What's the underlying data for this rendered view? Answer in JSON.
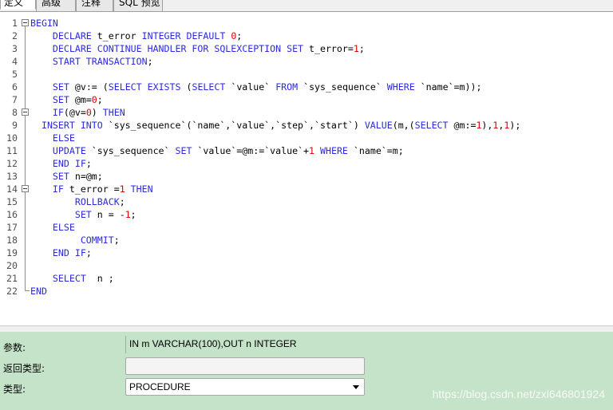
{
  "tabs": [
    {
      "label": "定义",
      "active": true
    },
    {
      "label": "高级",
      "active": false
    },
    {
      "label": "注释",
      "active": false
    },
    {
      "label": "SQL 预览",
      "active": false
    }
  ],
  "editor": {
    "lines": [
      {
        "n": "1",
        "tokens": [
          [
            "kw",
            "BEGIN"
          ]
        ]
      },
      {
        "n": "2",
        "tokens": [
          [
            "p",
            "    "
          ],
          [
            "kw",
            "DECLARE"
          ],
          [
            "p",
            " t_error "
          ],
          [
            "kw",
            "INTEGER DEFAULT"
          ],
          [
            "p",
            " "
          ],
          [
            "num",
            "0"
          ],
          [
            "p",
            ";"
          ]
        ]
      },
      {
        "n": "3",
        "tokens": [
          [
            "p",
            "    "
          ],
          [
            "kw",
            "DECLARE CONTINUE HANDLER FOR SQLEXCEPTION SET"
          ],
          [
            "p",
            " t_error="
          ],
          [
            "num",
            "1"
          ],
          [
            "p",
            ";"
          ]
        ]
      },
      {
        "n": "4",
        "tokens": [
          [
            "p",
            "    "
          ],
          [
            "kw",
            "START TRANSACTION"
          ],
          [
            "p",
            ";"
          ]
        ]
      },
      {
        "n": "5",
        "tokens": []
      },
      {
        "n": "6",
        "tokens": [
          [
            "p",
            "    "
          ],
          [
            "kw",
            "SET"
          ],
          [
            "p",
            " @v:= ("
          ],
          [
            "kw",
            "SELECT EXISTS"
          ],
          [
            "p",
            " ("
          ],
          [
            "kw",
            "SELECT"
          ],
          [
            "p",
            " `value` "
          ],
          [
            "kw",
            "FROM"
          ],
          [
            "p",
            " `sys_sequence` "
          ],
          [
            "kw",
            "WHERE"
          ],
          [
            "p",
            " `name`=m));"
          ]
        ]
      },
      {
        "n": "7",
        "tokens": [
          [
            "p",
            "    "
          ],
          [
            "kw",
            "SET"
          ],
          [
            "p",
            " @m="
          ],
          [
            "num",
            "0"
          ],
          [
            "p",
            ";"
          ]
        ]
      },
      {
        "n": "8",
        "tokens": [
          [
            "p",
            "    "
          ],
          [
            "kw",
            "IF"
          ],
          [
            "p",
            "(@v="
          ],
          [
            "num",
            "0"
          ],
          [
            "p",
            ") "
          ],
          [
            "kw",
            "THEN"
          ]
        ]
      },
      {
        "n": "9",
        "tokens": [
          [
            "p",
            "  "
          ],
          [
            "kw",
            "INSERT INTO"
          ],
          [
            "p",
            " `sys_sequence`(`name`,`value`,`step`,`start`) "
          ],
          [
            "kw",
            "VALUE"
          ],
          [
            "p",
            "(m,("
          ],
          [
            "kw",
            "SELECT"
          ],
          [
            "p",
            " @m:="
          ],
          [
            "num",
            "1"
          ],
          [
            "p",
            "),"
          ],
          [
            "num",
            "1"
          ],
          [
            "p",
            ","
          ],
          [
            "num",
            "1"
          ],
          [
            "p",
            ");"
          ]
        ]
      },
      {
        "n": "10",
        "tokens": [
          [
            "p",
            "    "
          ],
          [
            "kw",
            "ELSE"
          ]
        ]
      },
      {
        "n": "11",
        "tokens": [
          [
            "p",
            "    "
          ],
          [
            "kw",
            "UPDATE"
          ],
          [
            "p",
            " `sys_sequence` "
          ],
          [
            "kw",
            "SET"
          ],
          [
            "p",
            " `value`=@m:=`value`+"
          ],
          [
            "num",
            "1"
          ],
          [
            "p",
            " "
          ],
          [
            "kw",
            "WHERE"
          ],
          [
            "p",
            " `name`=m;"
          ]
        ]
      },
      {
        "n": "12",
        "tokens": [
          [
            "p",
            "    "
          ],
          [
            "kw",
            "END IF"
          ],
          [
            "p",
            ";"
          ]
        ]
      },
      {
        "n": "13",
        "tokens": [
          [
            "p",
            "    "
          ],
          [
            "kw",
            "SET"
          ],
          [
            "p",
            " n=@m;"
          ]
        ]
      },
      {
        "n": "14",
        "tokens": [
          [
            "p",
            "    "
          ],
          [
            "kw",
            "IF"
          ],
          [
            "p",
            " t_error ="
          ],
          [
            "num",
            "1"
          ],
          [
            "p",
            " "
          ],
          [
            "kw",
            "THEN"
          ]
        ]
      },
      {
        "n": "15",
        "tokens": [
          [
            "p",
            "        "
          ],
          [
            "kw",
            "ROLLBACK"
          ],
          [
            "p",
            ";"
          ]
        ]
      },
      {
        "n": "16",
        "tokens": [
          [
            "p",
            "        "
          ],
          [
            "kw",
            "SET"
          ],
          [
            "p",
            " n = -"
          ],
          [
            "num",
            "1"
          ],
          [
            "p",
            ";"
          ]
        ]
      },
      {
        "n": "17",
        "tokens": [
          [
            "p",
            "    "
          ],
          [
            "kw",
            "ELSE"
          ]
        ]
      },
      {
        "n": "18",
        "tokens": [
          [
            "p",
            "         "
          ],
          [
            "kw",
            "COMMIT"
          ],
          [
            "p",
            ";"
          ]
        ]
      },
      {
        "n": "19",
        "tokens": [
          [
            "p",
            "    "
          ],
          [
            "kw",
            "END IF"
          ],
          [
            "p",
            ";"
          ]
        ]
      },
      {
        "n": "20",
        "tokens": []
      },
      {
        "n": "21",
        "tokens": [
          [
            "p",
            "    "
          ],
          [
            "kw",
            "SELECT"
          ],
          [
            "p",
            "  n ;"
          ]
        ]
      },
      {
        "n": "22",
        "tokens": [
          [
            "kw",
            "END"
          ]
        ]
      }
    ]
  },
  "properties": {
    "params_label": "参数:",
    "params_value": "IN m VARCHAR(100),OUT n INTEGER",
    "return_label": "返回类型:",
    "return_value": "",
    "type_label": "类型:",
    "type_value": "PROCEDURE"
  },
  "watermark": "https://blog.csdn.net/zxl646801924",
  "colors": {
    "keyword": "#2b2bdb",
    "number": "#e00000",
    "panel_bg": "#c4e3c8"
  }
}
